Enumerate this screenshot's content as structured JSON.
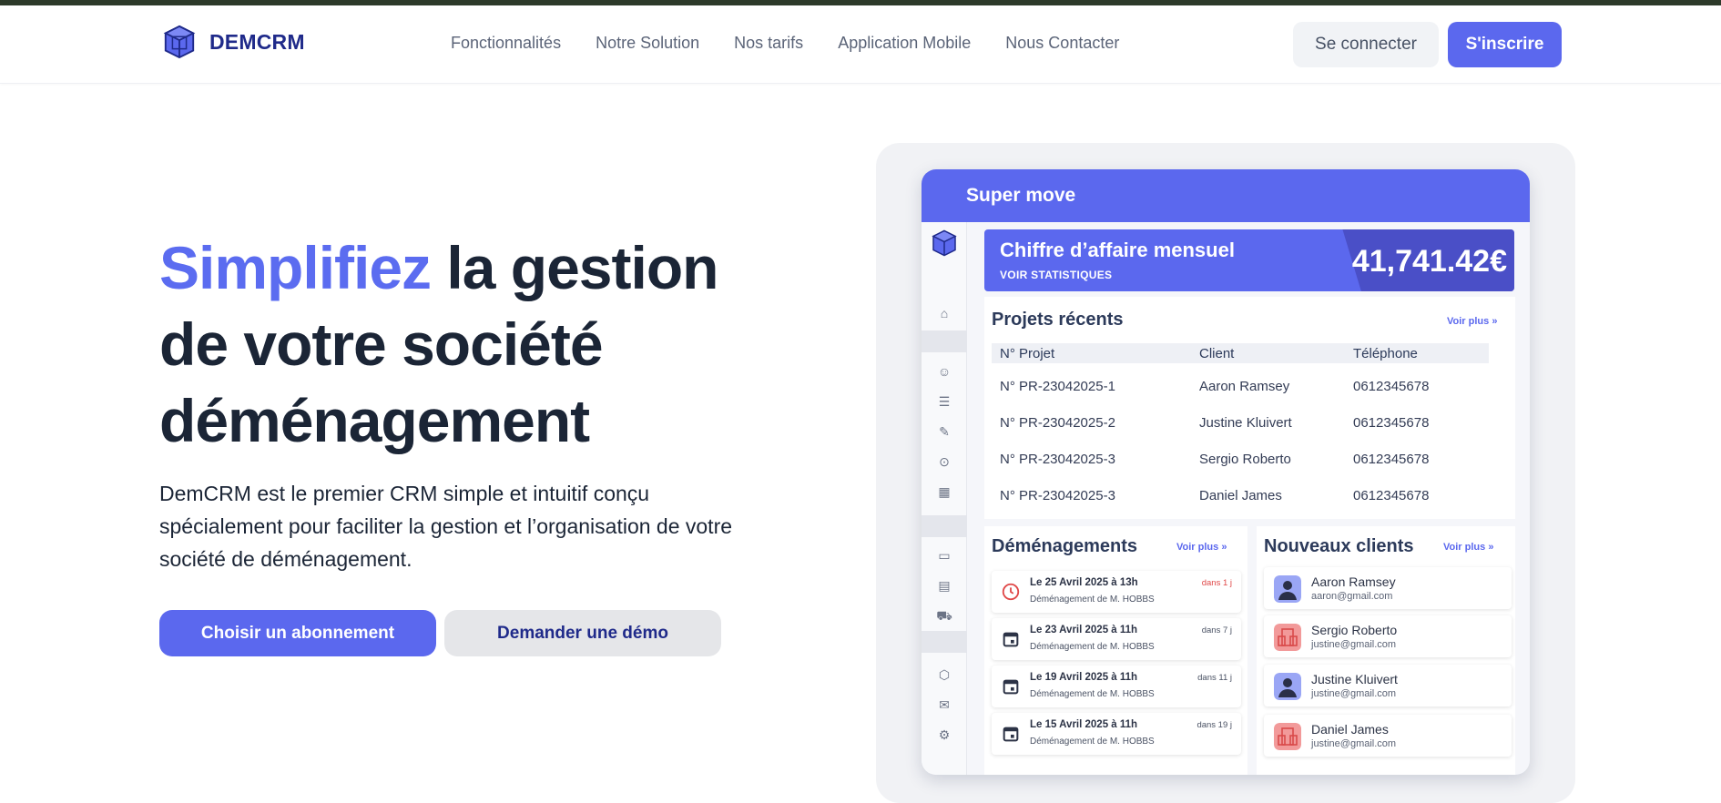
{
  "brand": {
    "name": "DEMCRM"
  },
  "nav": {
    "items": [
      "Fonctionnalités",
      "Notre Solution",
      "Nos tarifs",
      "Application Mobile",
      "Nous Contacter"
    ],
    "login_label": "Se connecter",
    "signup_label": "S'inscrire"
  },
  "hero": {
    "title_accent": "Simplifiez",
    "title_rest": " la gestion de votre société déménagement",
    "description": "DemCRM est le premier CRM simple et intuitif conçu spécialement pour faciliter la gestion et l’organisation de votre société de déménagement.",
    "cta_primary": "Choisir un abonnement",
    "cta_secondary": "Demander une démo"
  },
  "dashboard": {
    "app_name": "Super move",
    "revenue": {
      "title": "Chiffre d’affaire mensuel",
      "link": "VOIR STATISTIQUES",
      "amount": "41,741.42€"
    },
    "projects": {
      "title": "Projets récents",
      "more": "Voir plus",
      "columns": [
        "N° Projet",
        "Client",
        "Téléphone"
      ],
      "rows": [
        [
          "N° PR-23042025-1",
          "Aaron Ramsey",
          "0612345678"
        ],
        [
          "N° PR-23042025-2",
          "Justine Kluivert",
          "0612345678"
        ],
        [
          "N° PR-23042025-3",
          "Sergio Roberto",
          "0612345678"
        ],
        [
          "N° PR-23042025-3",
          "Daniel James",
          "0612345678"
        ]
      ]
    },
    "moves": {
      "title": "Déménagements",
      "more": "Voir plus",
      "items": [
        {
          "date": "Le 25 Avril 2025 à 13h",
          "label": "Déménagement de M. HOBBS",
          "due": "dans 1 j",
          "icon": "clock-icon",
          "color": "#e04848"
        },
        {
          "date": "Le 23 Avril 2025 à 11h",
          "label": "Déménagement de M. HOBBS",
          "due": "dans 7 j",
          "icon": "calendar-icon",
          "color": "#2c3346"
        },
        {
          "date": "Le 19 Avril 2025 à 11h",
          "label": "Déménagement de M. HOBBS",
          "due": "dans 11 j",
          "icon": "calendar-icon",
          "color": "#2c3346"
        },
        {
          "date": "Le 15 Avril 2025 à 11h",
          "label": "Déménagement de M. HOBBS",
          "due": "dans 19 j",
          "icon": "calendar-icon",
          "color": "#2c3346"
        }
      ]
    },
    "clients": {
      "title": "Nouveaux clients",
      "more": "Voir plus",
      "items": [
        {
          "name": "Aaron Ramsey",
          "email": "aaron@gmail.com",
          "avatar": "person-avatar",
          "color": "#9aa6f5"
        },
        {
          "name": "Sergio Roberto",
          "email": "justine@gmail.com",
          "avatar": "company-avatar",
          "color": "#f29a9a"
        },
        {
          "name": "Justine Kluivert",
          "email": "justine@gmail.com",
          "avatar": "person-avatar",
          "color": "#9aa6f5"
        },
        {
          "name": "Daniel James",
          "email": "justine@gmail.com",
          "avatar": "company-avatar",
          "color": "#f29a9a"
        }
      ]
    }
  },
  "colors": {
    "accent": "#5b68ee",
    "brand_dark": "#1f2a8a",
    "text": "#1b2536"
  }
}
